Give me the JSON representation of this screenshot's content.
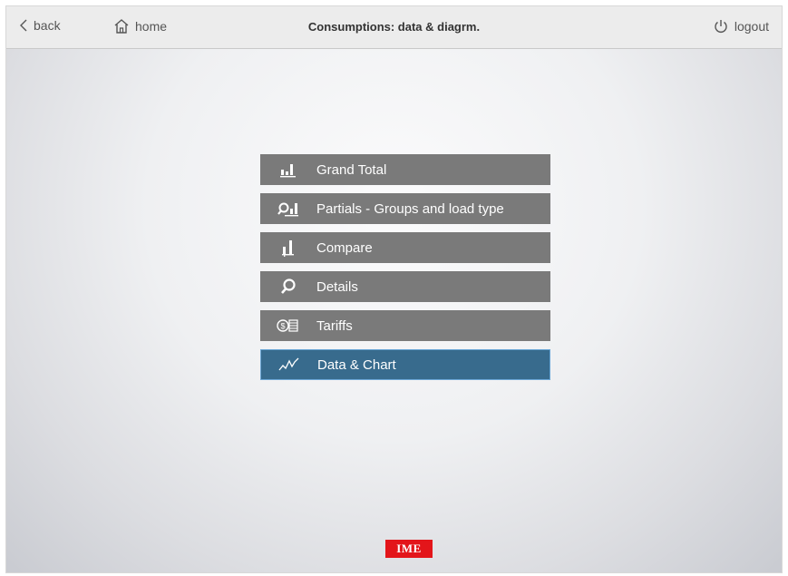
{
  "header": {
    "back_label": "back",
    "home_label": "home",
    "title": "Consumptions: data & diagrm.",
    "logout_label": "logout"
  },
  "menu": {
    "items": [
      {
        "label": "Grand Total",
        "icon": "bar-chart-icon"
      },
      {
        "label": "Partials - Groups and load type",
        "icon": "search-bar-chart-icon"
      },
      {
        "label": "Compare",
        "icon": "compare-bars-icon"
      },
      {
        "label": "Details",
        "icon": "search-icon"
      },
      {
        "label": "Tariffs",
        "icon": "coins-icon"
      },
      {
        "label": "Data & Chart",
        "icon": "line-chart-icon",
        "active": true
      }
    ]
  },
  "footer": {
    "logo_text": "IME"
  },
  "colors": {
    "menu_item": "#7a7a7a",
    "menu_item_active": "#386b8d",
    "logo": "#e3151a"
  }
}
